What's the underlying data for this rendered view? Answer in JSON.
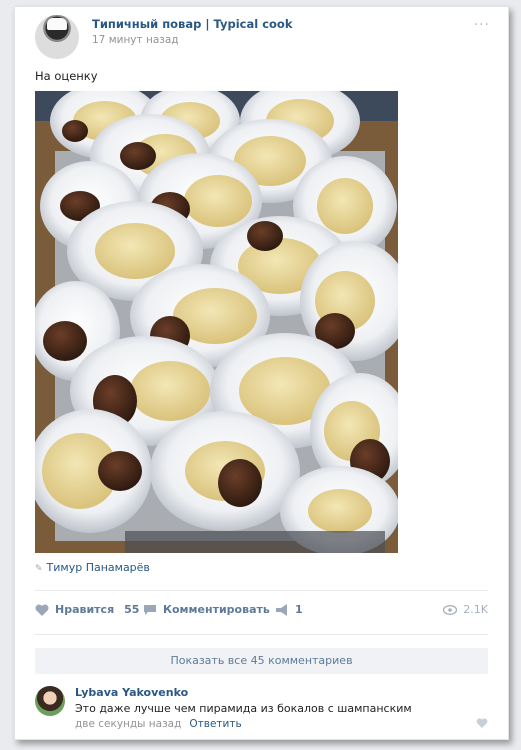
{
  "post": {
    "author": "Типичный повар | Typical cook",
    "time": "17 минут назад",
    "more": "···",
    "text": "На оценку",
    "source": "Тимур Панамарёв",
    "photo_alt": "plates with mashed potatoes and cutlets stacked in a pyramid"
  },
  "actions": {
    "like_label": "Нравится",
    "like_count": "55",
    "comment_label": "Комментировать",
    "share_count": "1",
    "views": "2.1K"
  },
  "comments": {
    "show_all": "Показать все 45 комментариев",
    "items": [
      {
        "author": "Lybava Yakovenko",
        "text": "Это даже лучше чем пирамида из бокалов с шампанским",
        "time": "две секунды назад",
        "reply": "Ответить"
      }
    ]
  },
  "colors": {
    "link": "#2a5885",
    "action": "#5f7a99",
    "muted": "#939393",
    "background": "#e9ebee"
  },
  "icons": [
    "heart-icon",
    "comment-icon",
    "share-icon",
    "eye-icon",
    "source-icon",
    "more-icon"
  ]
}
